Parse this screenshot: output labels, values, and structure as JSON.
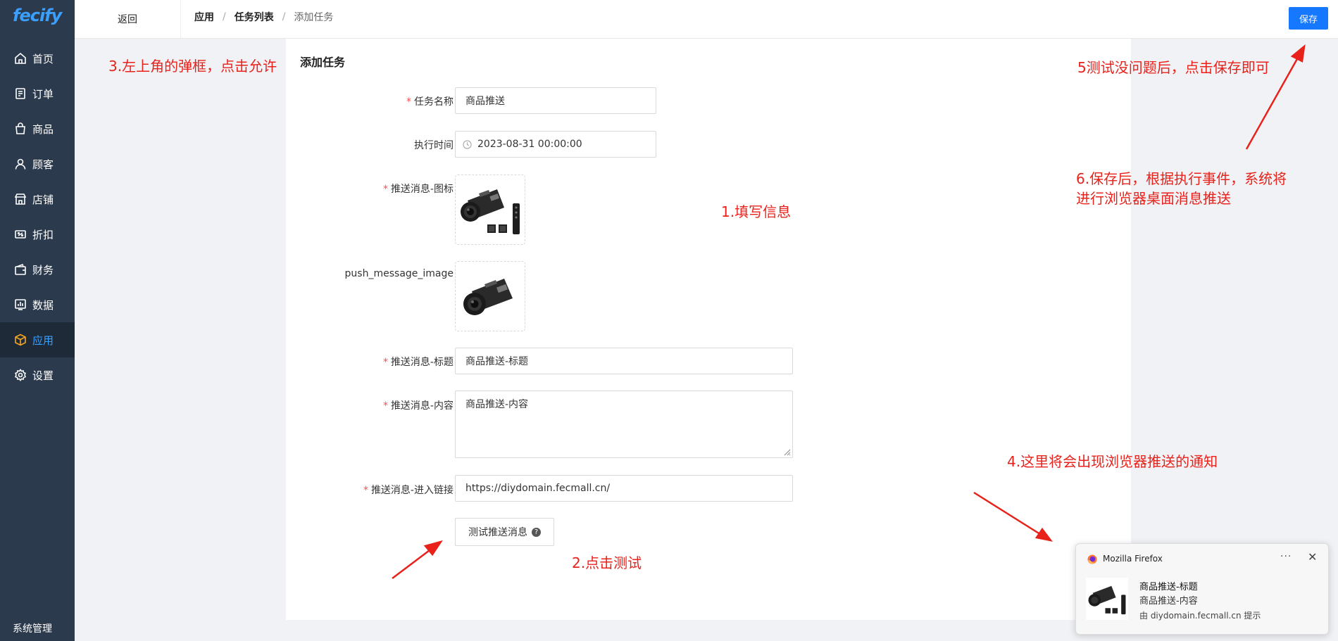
{
  "sidebar": {
    "logo": "fecify",
    "items": [
      {
        "label": "首页",
        "icon": "home-icon"
      },
      {
        "label": "订单",
        "icon": "order-icon"
      },
      {
        "label": "商品",
        "icon": "bag-icon"
      },
      {
        "label": "顾客",
        "icon": "user-icon"
      },
      {
        "label": "店铺",
        "icon": "store-icon"
      },
      {
        "label": "折扣",
        "icon": "discount-icon"
      },
      {
        "label": "财务",
        "icon": "wallet-icon"
      },
      {
        "label": "数据",
        "icon": "chart-icon"
      },
      {
        "label": "应用",
        "icon": "cube-icon",
        "active": true
      },
      {
        "label": "设置",
        "icon": "gear-icon"
      }
    ],
    "system_label": "系统管理",
    "accent_color": "#3aa0ff"
  },
  "header": {
    "back_label": "返回",
    "breadcrumb": [
      "应用",
      "任务列表",
      "添加任务"
    ],
    "save_label": "保存"
  },
  "form": {
    "title": "添加任务",
    "task_name": {
      "label": "任务名称",
      "value": "商品推送"
    },
    "exec_time": {
      "label": "执行时间",
      "value": "2023-08-31 00:00:00"
    },
    "icon_field": {
      "label": "推送消息-图标"
    },
    "image_field": {
      "label": "push_message_image"
    },
    "msg_title": {
      "label": "推送消息-标题",
      "value": "商品推送-标题"
    },
    "msg_content": {
      "label": "推送消息-内容",
      "value": "商品推送-内容"
    },
    "msg_link": {
      "label": "推送消息-进入链接",
      "value": "https://diydomain.fecmall.cn/"
    },
    "test_button": "测试推送消息",
    "required_mark": "*"
  },
  "annotations": {
    "a1": "1.填写信息",
    "a2": "2.点击测试",
    "a3": "3.左上角的弹框，点击允许",
    "a4": "4.这里将会出现浏览器推送的通知",
    "a5": "5测试没问题后，点击保存即可",
    "a6_line1": "6.保存后，根据执行事件，系统将",
    "a6_line2": "进行浏览器桌面消息推送",
    "color": "#e8221b"
  },
  "notification": {
    "app": "Mozilla Firefox",
    "more": "···",
    "close": "✕",
    "title": "商品推送-标题",
    "body": "商品推送-内容",
    "source": "由 diydomain.fecmall.cn 提示"
  }
}
